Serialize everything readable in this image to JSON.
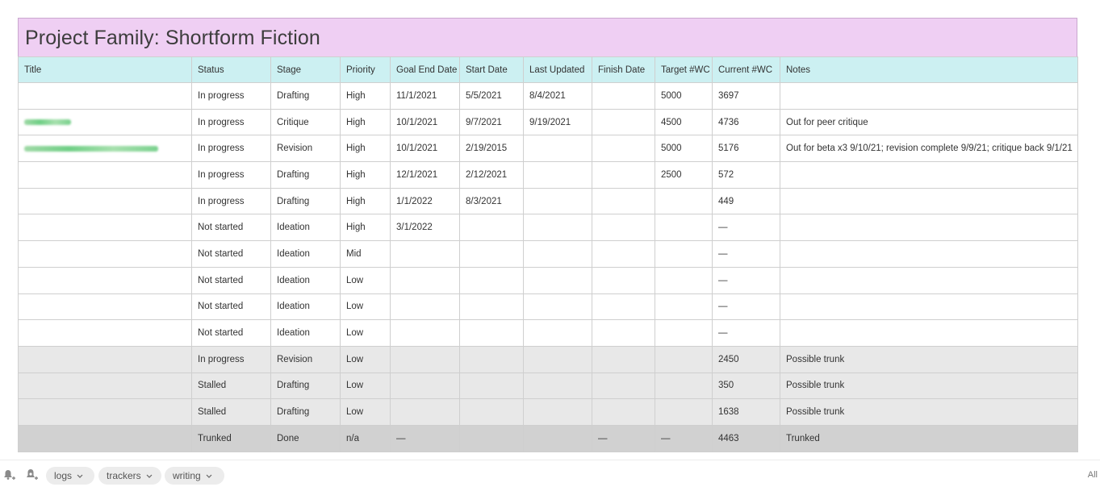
{
  "page_title": "Project Family: Shortform Fiction",
  "columns": [
    "Title",
    "Status",
    "Stage",
    "Priority",
    "Goal End Date",
    "Start Date",
    "Last Updated",
    "Finish Date",
    "Target #WC",
    "Current #WC",
    "Notes"
  ],
  "rows": [
    {
      "style": "normal",
      "title_blur": 0,
      "cells": [
        "",
        "In progress",
        "Drafting",
        "High",
        "11/1/2021",
        "5/5/2021",
        "8/4/2021",
        "",
        "5000",
        "3697",
        ""
      ]
    },
    {
      "style": "normal",
      "title_blur": 1,
      "cells": [
        "",
        "In progress",
        "Critique",
        "High",
        "10/1/2021",
        "9/7/2021",
        "9/19/2021",
        "",
        "4500",
        "4736",
        "Out for peer critique"
      ]
    },
    {
      "style": "normal",
      "title_blur": 2,
      "cells": [
        "",
        "In progress",
        "Revision",
        "High",
        "10/1/2021",
        "2/19/2015",
        "",
        "",
        "5000",
        "5176",
        "Out for beta x3 9/10/21; revision complete 9/9/21; critique back 9/1/21"
      ]
    },
    {
      "style": "normal",
      "title_blur": 0,
      "cells": [
        "",
        "In progress",
        "Drafting",
        "High",
        "12/1/2021",
        "2/12/2021",
        "",
        "",
        "2500",
        "572",
        ""
      ]
    },
    {
      "style": "normal",
      "title_blur": 0,
      "cells": [
        "",
        "In progress",
        "Drafting",
        "High",
        "1/1/2022",
        "8/3/2021",
        "",
        "",
        "",
        "449",
        ""
      ]
    },
    {
      "style": "normal",
      "title_blur": 0,
      "cells": [
        "",
        "Not started",
        "Ideation",
        "High",
        "3/1/2022",
        "",
        "",
        "",
        "",
        "—",
        ""
      ]
    },
    {
      "style": "normal",
      "title_blur": 0,
      "cells": [
        "",
        "Not started",
        "Ideation",
        "Mid",
        "",
        "",
        "",
        "",
        "",
        "—",
        ""
      ]
    },
    {
      "style": "normal",
      "title_blur": 0,
      "cells": [
        "",
        "Not started",
        "Ideation",
        "Low",
        "",
        "",
        "",
        "",
        "",
        "—",
        ""
      ]
    },
    {
      "style": "normal",
      "title_blur": 0,
      "cells": [
        "",
        "Not started",
        "Ideation",
        "Low",
        "",
        "",
        "",
        "",
        "",
        "—",
        ""
      ]
    },
    {
      "style": "normal",
      "title_blur": 0,
      "cells": [
        "",
        "Not started",
        "Ideation",
        "Low",
        "",
        "",
        "",
        "",
        "",
        "—",
        ""
      ]
    },
    {
      "style": "gray",
      "title_blur": 0,
      "cells": [
        "",
        "In progress",
        "Revision",
        "Low",
        "",
        "",
        "",
        "",
        "",
        "2450",
        "Possible trunk"
      ]
    },
    {
      "style": "gray",
      "title_blur": 0,
      "cells": [
        "",
        "Stalled",
        "Drafting",
        "Low",
        "",
        "",
        "",
        "",
        "",
        "350",
        "Possible trunk"
      ]
    },
    {
      "style": "gray",
      "title_blur": 0,
      "cells": [
        "",
        "Stalled",
        "Drafting",
        "Low",
        "",
        "",
        "",
        "",
        "",
        "1638",
        "Possible trunk"
      ]
    },
    {
      "style": "dark",
      "title_blur": 0,
      "cells": [
        "",
        "Trunked",
        "Done",
        "n/a",
        "—",
        "",
        "",
        "—",
        "—",
        "4463",
        "Trunked"
      ]
    }
  ],
  "footer": {
    "tags": [
      {
        "label": "logs"
      },
      {
        "label": "trackers"
      },
      {
        "label": "writing"
      }
    ],
    "all_label": "All",
    "icons": [
      "bell-add-icon",
      "bell-pin-icon"
    ]
  }
}
